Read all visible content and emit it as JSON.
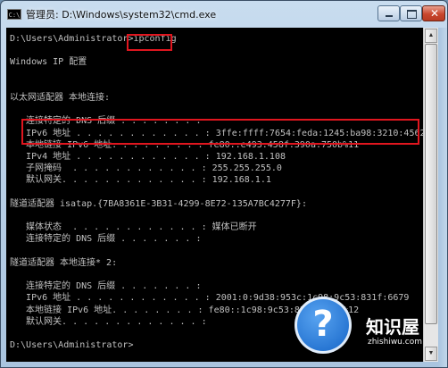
{
  "window": {
    "title": "管理员: D:\\Windows\\system32\\cmd.exe",
    "icon": "cmd-icon",
    "controls": {
      "minimize": "minimize-icon",
      "maximize": "maximize-icon",
      "close": "✕"
    }
  },
  "console": {
    "lines": [
      "D:\\Users\\Administrator>ipconfig",
      "",
      "Windows IP 配置",
      "",
      "",
      "以太网适配器 本地连接:",
      "",
      "   连接特定的 DNS 后缀 . . . . . . . :",
      "   IPv6 地址 . . . . . . . . . . . . : 3ffe:ffff:7654:feda:1245:ba98:3210:4562",
      "   本地链接 IPv6 地址. . . . . . . . : fe80::e493:458f:390a:750b%11",
      "   IPv4 地址 . . . . . . . . . . . . : 192.168.1.108",
      "   子网掩码  . . . . . . . . . . . . : 255.255.255.0",
      "   默认网关. . . . . . . . . . . . . : 192.168.1.1",
      "",
      "隧道适配器 isatap.{7BA8361E-3B31-4299-8E72-135A7BC4277F}:",
      "",
      "   媒体状态  . . . . . . . . . . . . : 媒体已断开",
      "   连接特定的 DNS 后缀 . . . . . . . :",
      "",
      "隧道适配器 本地连接* 2:",
      "",
      "   连接特定的 DNS 后缀 . . . . . . . :",
      "   IPv6 地址 . . . . . . . . . . . . : 2001:0:9d38:953c:1c98:9c53:831f:6679",
      "   本地链接 IPv6 地址. . . . . . . . : fe80::1c98:9c53:831f:6679%12",
      "   默认网关. . . . . . . . . . . . . :",
      "",
      "D:\\Users\\Administrator>"
    ]
  },
  "watermark": {
    "brand": "知识屋",
    "url": "zhishiwu.com",
    "icon": "question-mark-icon"
  },
  "colors": {
    "console_bg": "#000000",
    "console_text": "#c0c0c0",
    "highlight": "#e0161f"
  }
}
